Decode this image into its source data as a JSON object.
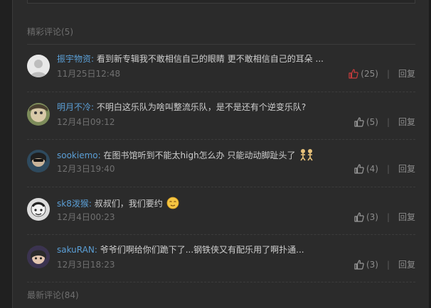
{
  "hot_section": {
    "title": "精彩评论",
    "count": "(5)"
  },
  "new_section": {
    "title": "最新评论",
    "count": "(84)"
  },
  "reply_label": "回复",
  "comments": [
    {
      "username": "振宇物资",
      "text": "看到新专辑我不敢相信自己的眼睛 更不敢相信自己的耳朵 ...",
      "time": "11月25日12:48",
      "likes": "(25)",
      "liked": true,
      "emoji": ""
    },
    {
      "username": "明月不冷",
      "text": "不明白这乐队为啥叫整流乐队，是不是还有个逆变乐队?",
      "time": "12月4日09:12",
      "likes": "(5)",
      "liked": false,
      "emoji": ""
    },
    {
      "username": "sookiemo",
      "text": "在图书馆听到不能太high怎么办 只能动动脚趾头了",
      "time": "12月3日19:40",
      "likes": "(4)",
      "liked": false,
      "emoji": "dancers-emoji"
    },
    {
      "username": "sk8泼猴",
      "text": "叔叔们，我们要约",
      "time": "12月4日00:23",
      "likes": "(3)",
      "liked": false,
      "emoji": "relieved-face-emoji"
    },
    {
      "username": "sakuRAN",
      "text": "爷爷们啊给你们跪下了...钢铁侠又有配乐用了啊扑通...",
      "time": "12月3日18:23",
      "likes": "(3)",
      "liked": false,
      "emoji": ""
    }
  ],
  "colors": {
    "background": "#2b2b2b",
    "username": "#5b9fd6",
    "liked_icon": "#c83c3c",
    "muted_text": "#707070"
  }
}
